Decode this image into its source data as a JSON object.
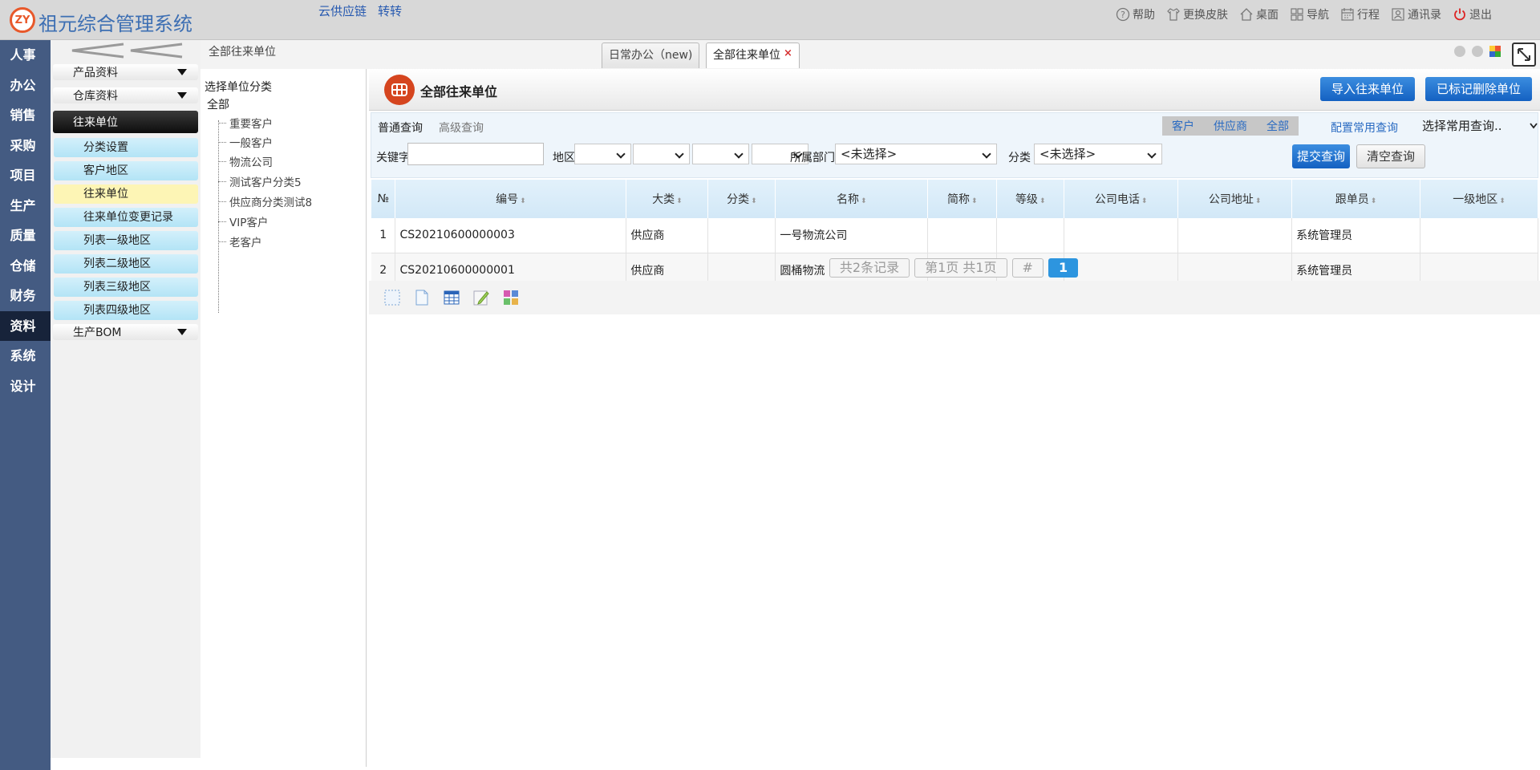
{
  "header": {
    "logo_text": "ZY",
    "app_title": "祖元综合管理系统",
    "links": [
      "云供应链",
      "转转"
    ],
    "tools": [
      {
        "label": "帮助",
        "icon": "help-icon"
      },
      {
        "label": "更换皮肤",
        "icon": "shirt-icon"
      },
      {
        "label": "桌面",
        "icon": "home-icon"
      },
      {
        "label": "导航",
        "icon": "grid-icon"
      },
      {
        "label": "行程",
        "icon": "calendar-icon"
      },
      {
        "label": "通讯录",
        "icon": "contacts-icon"
      },
      {
        "label": "退出",
        "icon": "power-icon"
      }
    ]
  },
  "rail": {
    "items": [
      "人事",
      "办公",
      "销售",
      "采购",
      "项目",
      "生产",
      "质量",
      "仓储",
      "财务",
      "资料",
      "系统",
      "设计"
    ],
    "active": "资料"
  },
  "submenu": {
    "groups": [
      {
        "label": "产品资料"
      },
      {
        "label": "仓库资料"
      },
      {
        "label": "往来单位"
      }
    ],
    "items": [
      "分类设置",
      "客户地区",
      "往来单位",
      "往来单位变更记录",
      "列表一级地区",
      "列表二级地区",
      "列表三级地区",
      "列表四级地区"
    ],
    "active_item": "往来单位",
    "last_group": "生产BOM"
  },
  "breadcrumb": "全部往来单位",
  "tabs": [
    {
      "label": "日常办公（new)"
    },
    {
      "label": "全部往来单位",
      "close": "×"
    }
  ],
  "tree": {
    "title": "选择单位分类",
    "root": "全部",
    "nodes": [
      "重要客户",
      "一般客户",
      "物流公司",
      "测试客户分类5",
      "供应商分类测试8",
      "VIP客户",
      "老客户"
    ]
  },
  "panel": {
    "title": "全部往来单位",
    "import_button": "导入往来单位",
    "deleted_button": "已标记删除单位"
  },
  "query": {
    "tab_normal": "普通查询",
    "tab_advanced": "高级查询",
    "types": [
      "客户",
      "供应商",
      "全部"
    ],
    "config": "配置常用查询",
    "common_select": "选择常用查询..",
    "keyword_label": "关键字",
    "keyword_value": "",
    "region_label": "地区",
    "dept_label": "所属部门",
    "dept_value": "<未选择>",
    "category_label": "分类",
    "category_value": "<未选择>",
    "submit": "提交查询",
    "clear": "清空查询"
  },
  "table": {
    "columns": [
      "№",
      "编号",
      "大类",
      "分类",
      "名称",
      "简称",
      "等级",
      "公司电话",
      "公司地址",
      "跟单员",
      "一级地区"
    ],
    "rows": [
      {
        "n": "1",
        "code": "CS20210600000003",
        "major": "供应商",
        "cat": "",
        "name": "一号物流公司",
        "short": "",
        "grade": "",
        "phone": "",
        "addr": "",
        "owner": "系统管理员",
        "region": ""
      },
      {
        "n": "2",
        "code": "CS20210600000001",
        "major": "供应商",
        "cat": "",
        "name": "圆桶物流",
        "short": "",
        "grade": "",
        "phone": "",
        "addr": "",
        "owner": "系统管理员",
        "region": ""
      }
    ]
  },
  "pager": {
    "records": "共2条记录",
    "pages": "第1页 共1页",
    "hash": "#",
    "current": "1"
  },
  "colors": {
    "rail_bg": "#445b82",
    "primary_button": "#1461c2",
    "brand_red": "#d5451f",
    "header_bg": "#d8d8d8"
  }
}
